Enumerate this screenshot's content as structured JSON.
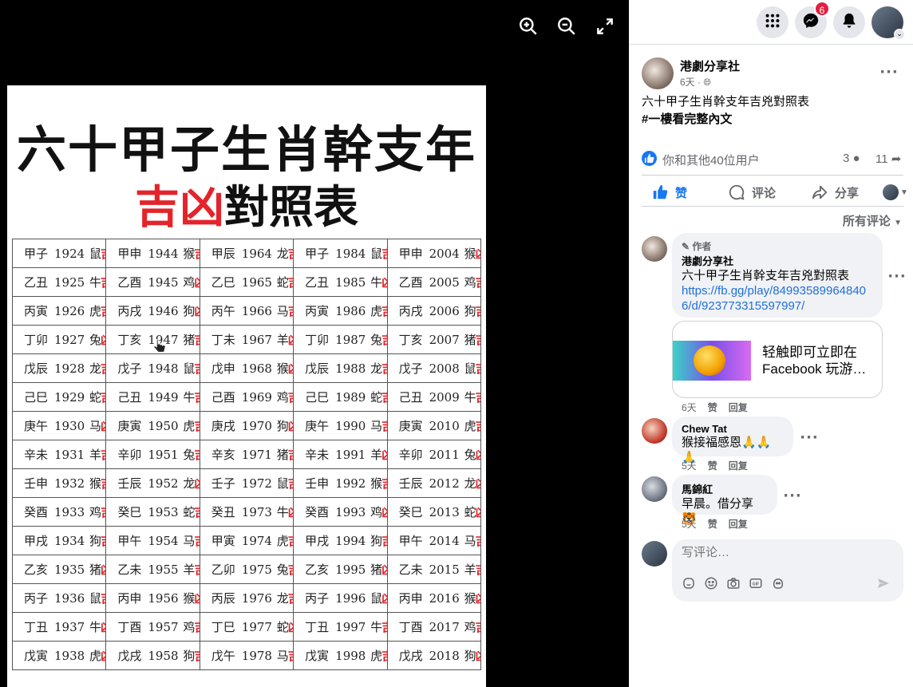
{
  "viewer": {
    "photo_title_line1": "六十甲子生肖幹支年",
    "photo_title_line2_red": "吉凶",
    "photo_title_line2_black": "對照表",
    "table_rows": [
      [
        [
          "甲子",
          "1924",
          "鼠",
          "吉"
        ],
        [
          "甲申",
          "1944",
          "猴",
          "吉"
        ],
        [
          "甲辰",
          "1964",
          "龙",
          "吉"
        ],
        [
          "甲子",
          "1984",
          "鼠",
          "吉"
        ],
        [
          "甲申",
          "2004",
          "猴",
          "凶"
        ]
      ],
      [
        [
          "乙丑",
          "1925",
          "牛",
          "吉"
        ],
        [
          "乙酉",
          "1945",
          "鸡",
          "凶"
        ],
        [
          "乙巳",
          "1965",
          "蛇",
          "吉"
        ],
        [
          "乙丑",
          "1985",
          "牛",
          "凶"
        ],
        [
          "乙酉",
          "2005",
          "鸡",
          "吉"
        ]
      ],
      [
        [
          "丙寅",
          "1926",
          "虎",
          "吉"
        ],
        [
          "丙戌",
          "1946",
          "狗",
          "凶"
        ],
        [
          "丙午",
          "1966",
          "马",
          "吉"
        ],
        [
          "丙寅",
          "1986",
          "虎",
          "吉"
        ],
        [
          "丙戌",
          "2006",
          "狗",
          "吉"
        ]
      ],
      [
        [
          "丁卯",
          "1927",
          "兔",
          "凶"
        ],
        [
          "丁亥",
          "1947",
          "猪",
          "吉"
        ],
        [
          "丁未",
          "1967",
          "羊",
          "凶"
        ],
        [
          "丁卯",
          "1987",
          "兔",
          "吉"
        ],
        [
          "丁亥",
          "2007",
          "猪",
          "吉"
        ]
      ],
      [
        [
          "戊辰",
          "1928",
          "龙",
          "吉"
        ],
        [
          "戊子",
          "1948",
          "鼠",
          "吉"
        ],
        [
          "戊申",
          "1968",
          "猴",
          "凶"
        ],
        [
          "戊辰",
          "1988",
          "龙",
          "吉"
        ],
        [
          "戊子",
          "2008",
          "鼠",
          "吉"
        ]
      ],
      [
        [
          "己巳",
          "1929",
          "蛇",
          "吉"
        ],
        [
          "己丑",
          "1949",
          "牛",
          "吉"
        ],
        [
          "己酉",
          "1969",
          "鸡",
          "吉"
        ],
        [
          "己巳",
          "1989",
          "蛇",
          "吉"
        ],
        [
          "己丑",
          "2009",
          "牛",
          "吉"
        ]
      ],
      [
        [
          "庚午",
          "1930",
          "马",
          "凶"
        ],
        [
          "庚寅",
          "1950",
          "虎",
          "吉"
        ],
        [
          "庚戌",
          "1970",
          "狗",
          "凶"
        ],
        [
          "庚午",
          "1990",
          "马",
          "吉"
        ],
        [
          "庚寅",
          "2010",
          "虎",
          "吉"
        ]
      ],
      [
        [
          "辛未",
          "1931",
          "羊",
          "吉"
        ],
        [
          "辛卯",
          "1951",
          "兔",
          "吉"
        ],
        [
          "辛亥",
          "1971",
          "猪",
          "吉"
        ],
        [
          "辛未",
          "1991",
          "羊",
          "凶"
        ],
        [
          "辛卯",
          "2011",
          "兔",
          "凶"
        ]
      ],
      [
        [
          "壬申",
          "1932",
          "猴",
          "吉"
        ],
        [
          "壬辰",
          "1952",
          "龙",
          "凶"
        ],
        [
          "壬子",
          "1972",
          "鼠",
          "吉"
        ],
        [
          "壬申",
          "1992",
          "猴",
          "吉"
        ],
        [
          "壬辰",
          "2012",
          "龙",
          "凶"
        ]
      ],
      [
        [
          "癸酉",
          "1933",
          "鸡",
          "吉"
        ],
        [
          "癸巳",
          "1953",
          "蛇",
          "吉"
        ],
        [
          "癸丑",
          "1973",
          "牛",
          "凶"
        ],
        [
          "癸酉",
          "1993",
          "鸡",
          "凶"
        ],
        [
          "癸巳",
          "2013",
          "蛇",
          "凶"
        ]
      ],
      [
        [
          "甲戌",
          "1934",
          "狗",
          "吉"
        ],
        [
          "甲午",
          "1954",
          "马",
          "吉"
        ],
        [
          "甲寅",
          "1974",
          "虎",
          "吉"
        ],
        [
          "甲戌",
          "1994",
          "狗",
          "吉"
        ],
        [
          "甲午",
          "2014",
          "马",
          "吉"
        ]
      ],
      [
        [
          "乙亥",
          "1935",
          "猪",
          "凶"
        ],
        [
          "乙未",
          "1955",
          "羊",
          "吉"
        ],
        [
          "乙卯",
          "1975",
          "兔",
          "吉"
        ],
        [
          "乙亥",
          "1995",
          "猪",
          "凶"
        ],
        [
          "乙未",
          "2015",
          "羊",
          "吉"
        ]
      ],
      [
        [
          "丙子",
          "1936",
          "鼠",
          "吉"
        ],
        [
          "丙申",
          "1956",
          "猴",
          "凶"
        ],
        [
          "丙辰",
          "1976",
          "龙",
          "吉"
        ],
        [
          "丙子",
          "1996",
          "鼠",
          "凶"
        ],
        [
          "丙申",
          "2016",
          "猴",
          "凶"
        ]
      ],
      [
        [
          "丁丑",
          "1937",
          "牛",
          "凶"
        ],
        [
          "丁酉",
          "1957",
          "鸡",
          "吉"
        ],
        [
          "丁巳",
          "1977",
          "蛇",
          "凶"
        ],
        [
          "丁丑",
          "1997",
          "牛",
          "吉"
        ],
        [
          "丁酉",
          "2017",
          "鸡",
          "吉"
        ]
      ],
      [
        [
          "戊寅",
          "1938",
          "虎",
          "凶"
        ],
        [
          "戊戌",
          "1958",
          "狗",
          "吉"
        ],
        [
          "戊午",
          "1978",
          "马",
          "吉"
        ],
        [
          "戊寅",
          "1998",
          "虎",
          "吉"
        ],
        [
          "戊戌",
          "2018",
          "狗",
          "凶"
        ]
      ]
    ]
  },
  "topbar": {
    "messenger_badge": "6"
  },
  "post": {
    "author": "港劇分享社",
    "time": "6天 · ",
    "text": "六十甲子生肖幹支年吉兇對照表",
    "hashtag": "#一樓看完整內文",
    "reactions_text": "你和其他40位用户",
    "comment_count": "3",
    "share_count": "11",
    "actions": {
      "like": "赞",
      "comment": "评论",
      "share": "分享"
    },
    "sort_label": "所有评论"
  },
  "comments": [
    {
      "author_badge": "作者",
      "name": "港劇分享社",
      "text": "六十甲子生肖幹支年吉兇對照表",
      "link": "https://fb.gg/play/849935899648406/d/923773315597997/",
      "card_text": "轻触即可立即在 Facebook 玩游…",
      "time": "6天",
      "like": "赞",
      "reply": "回复"
    },
    {
      "name": "Chew Tat",
      "text": "猴接福感恩🙏🙏🙏",
      "time": "5天",
      "like": "赞",
      "reply": "回复"
    },
    {
      "name": "馬錦紅",
      "text": "早晨。借分享🐯",
      "time": "5天",
      "like": "赞",
      "reply": "回复"
    }
  ],
  "composer": {
    "placeholder": "写评论…"
  },
  "colors": {
    "accent": "#1877f2",
    "red": "#e3242b"
  },
  "icons": [
    "zoom-in-icon",
    "zoom-out-icon",
    "fullscreen-icon",
    "menu-grid-icon",
    "messenger-icon",
    "bell-icon",
    "like-icon",
    "comment-icon",
    "share-icon",
    "globe-icon",
    "pencil-icon",
    "sticker-icon",
    "emoji-icon",
    "camera-icon",
    "gif-icon",
    "send-icon"
  ]
}
